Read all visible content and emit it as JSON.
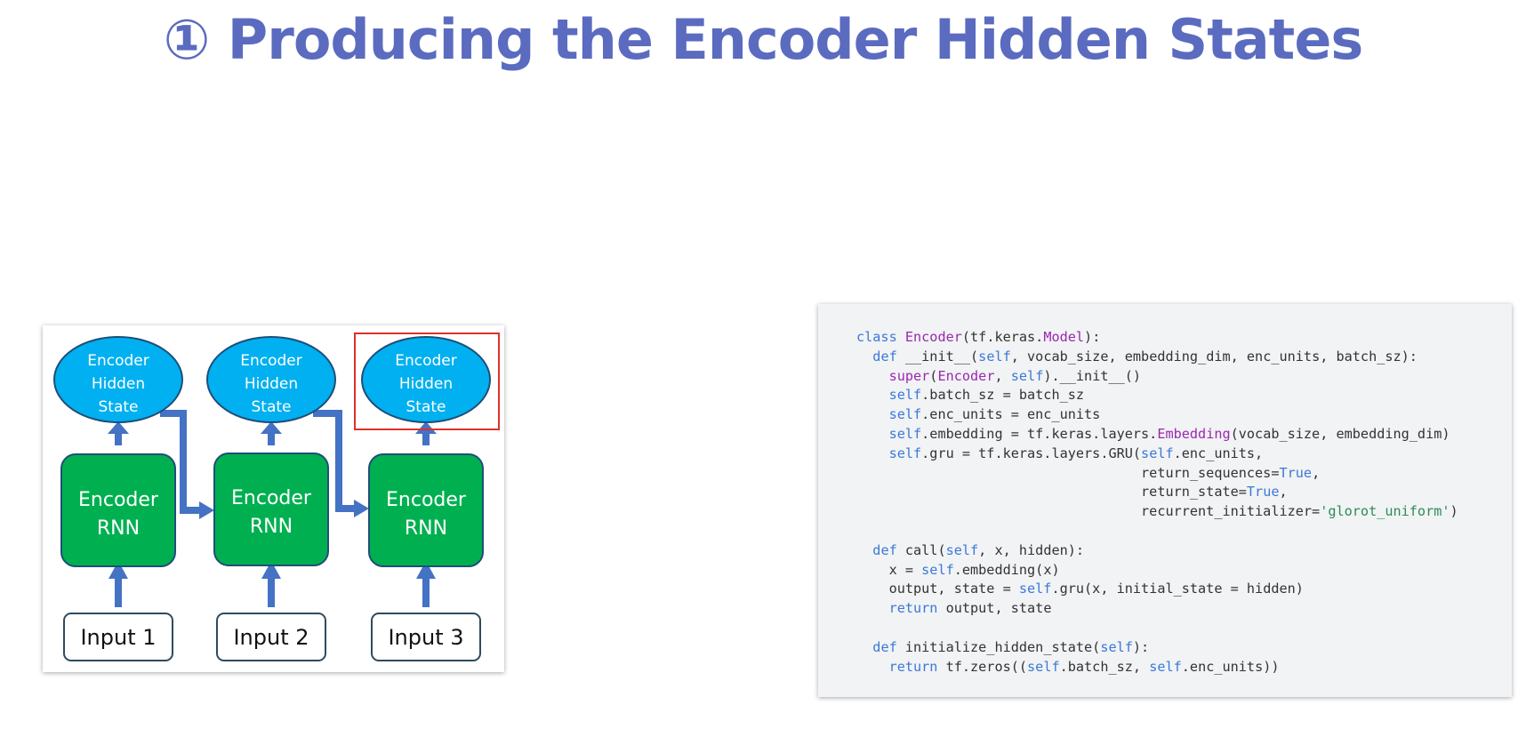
{
  "title": "① Producing the Encoder Hidden States",
  "diagram": {
    "states": [
      {
        "line1": "Encoder",
        "line2": "Hidden",
        "line3": "State"
      },
      {
        "line1": "Encoder",
        "line2": "Hidden",
        "line3": "State"
      },
      {
        "line1": "Encoder",
        "line2": "Hidden",
        "line3": "State"
      }
    ],
    "rnns": [
      {
        "line1": "Encoder",
        "line2": "RNN"
      },
      {
        "line1": "Encoder",
        "line2": "RNN"
      },
      {
        "line1": "Encoder",
        "line2": "RNN"
      }
    ],
    "inputs": [
      "Input 1",
      "Input 2",
      "Input 3"
    ],
    "colors": {
      "state_fill": "#00b0f0",
      "rnn_fill": "#00b050",
      "arrow": "#4472c4",
      "highlight": "#e0302a"
    }
  },
  "code": {
    "lines": [
      [
        {
          "t": "class ",
          "c": "kw"
        },
        {
          "t": "Encoder",
          "c": "cls"
        },
        {
          "t": "(tf.keras."
        },
        {
          "t": "Model",
          "c": "cls"
        },
        {
          "t": "):"
        }
      ],
      [
        {
          "t": "  "
        },
        {
          "t": "def ",
          "c": "kw"
        },
        {
          "t": "__init__("
        },
        {
          "t": "self",
          "c": "kw"
        },
        {
          "t": ", vocab_size, embedding_dim, enc_units, batch_sz):"
        }
      ],
      [
        {
          "t": "    "
        },
        {
          "t": "super",
          "c": "cls"
        },
        {
          "t": "("
        },
        {
          "t": "Encoder",
          "c": "cls"
        },
        {
          "t": ", "
        },
        {
          "t": "self",
          "c": "kw"
        },
        {
          "t": ").__init__()"
        }
      ],
      [
        {
          "t": "    "
        },
        {
          "t": "self",
          "c": "kw"
        },
        {
          "t": ".batch_sz = batch_sz"
        }
      ],
      [
        {
          "t": "    "
        },
        {
          "t": "self",
          "c": "kw"
        },
        {
          "t": ".enc_units = enc_units"
        }
      ],
      [
        {
          "t": "    "
        },
        {
          "t": "self",
          "c": "kw"
        },
        {
          "t": ".embedding = tf.keras.layers."
        },
        {
          "t": "Embedding",
          "c": "cls"
        },
        {
          "t": "(vocab_size, embedding_dim)"
        }
      ],
      [
        {
          "t": "    "
        },
        {
          "t": "self",
          "c": "kw"
        },
        {
          "t": ".gru = tf.keras.layers.GRU("
        },
        {
          "t": "self",
          "c": "kw"
        },
        {
          "t": ".enc_units,"
        }
      ],
      [
        {
          "t": "                                   return_sequences="
        },
        {
          "t": "True",
          "c": "kw"
        },
        {
          "t": ","
        }
      ],
      [
        {
          "t": "                                   return_state="
        },
        {
          "t": "True",
          "c": "kw"
        },
        {
          "t": ","
        }
      ],
      [
        {
          "t": "                                   recurrent_initializer="
        },
        {
          "t": "'glorot_uniform'",
          "c": "str"
        },
        {
          "t": ")"
        }
      ],
      [
        {
          "t": " "
        }
      ],
      [
        {
          "t": "  "
        },
        {
          "t": "def ",
          "c": "kw"
        },
        {
          "t": "call("
        },
        {
          "t": "self",
          "c": "kw"
        },
        {
          "t": ", x, hidden):"
        }
      ],
      [
        {
          "t": "    x = "
        },
        {
          "t": "self",
          "c": "kw"
        },
        {
          "t": ".embedding(x)"
        }
      ],
      [
        {
          "t": "    output, state = "
        },
        {
          "t": "self",
          "c": "kw"
        },
        {
          "t": ".gru(x, initial_state = hidden)"
        }
      ],
      [
        {
          "t": "    "
        },
        {
          "t": "return ",
          "c": "kw"
        },
        {
          "t": "output, state"
        }
      ],
      [
        {
          "t": " "
        }
      ],
      [
        {
          "t": "  "
        },
        {
          "t": "def ",
          "c": "kw"
        },
        {
          "t": "initialize_hidden_state("
        },
        {
          "t": "self",
          "c": "kw"
        },
        {
          "t": "):"
        }
      ],
      [
        {
          "t": "    "
        },
        {
          "t": "return ",
          "c": "kw"
        },
        {
          "t": "tf.zeros(("
        },
        {
          "t": "self",
          "c": "kw"
        },
        {
          "t": ".batch_sz, "
        },
        {
          "t": "self",
          "c": "kw"
        },
        {
          "t": ".enc_units))"
        }
      ]
    ]
  }
}
